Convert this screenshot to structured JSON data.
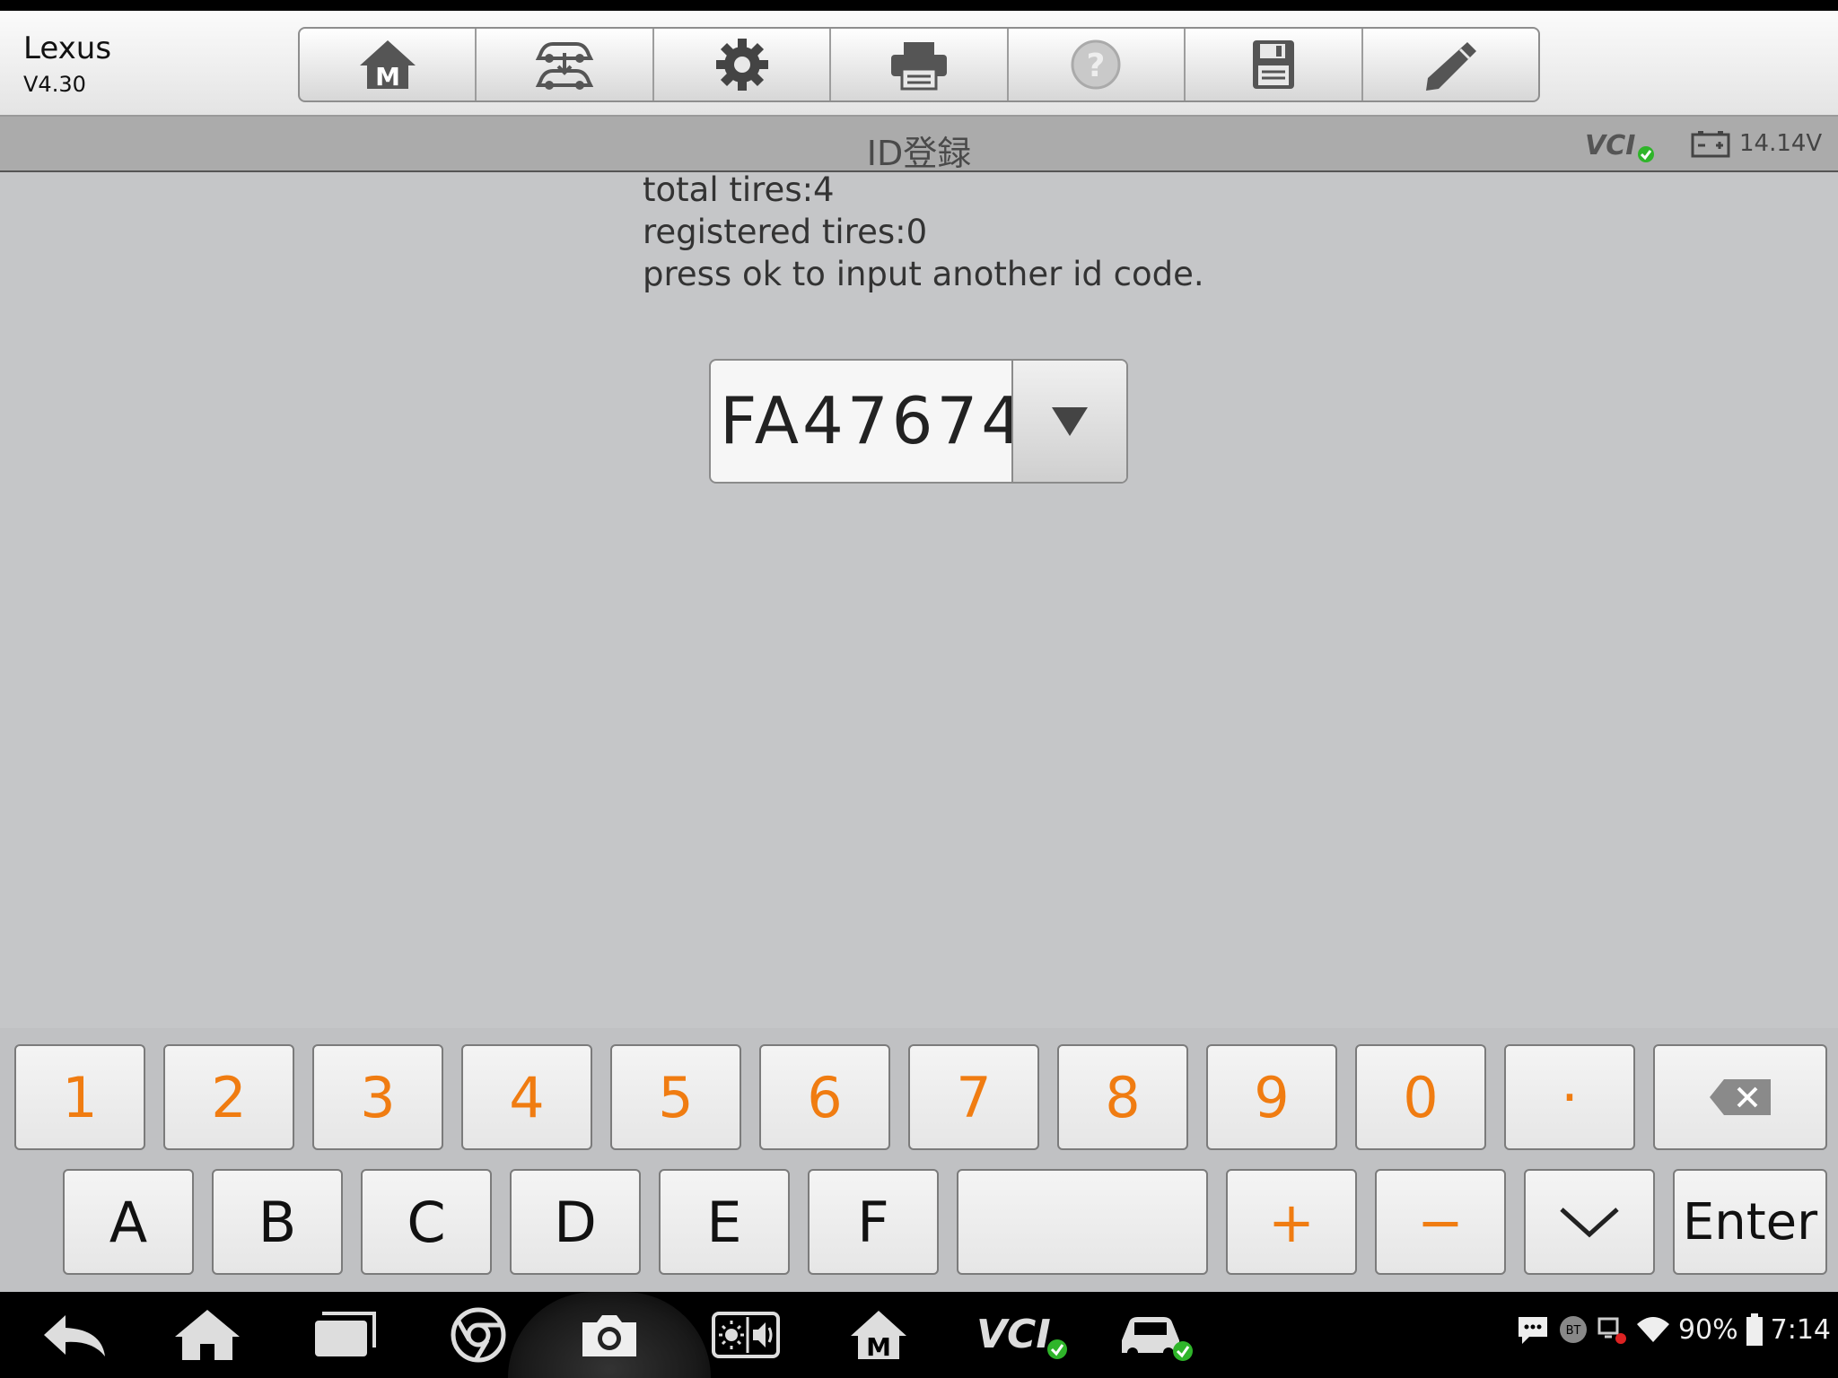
{
  "app": {
    "title": "Lexus",
    "version": "V4.30"
  },
  "toolbar": [
    {
      "icon": "home-m-icon"
    },
    {
      "icon": "vehicle-swap-icon"
    },
    {
      "icon": "gear-icon"
    },
    {
      "icon": "printer-icon"
    },
    {
      "icon": "help-icon"
    },
    {
      "icon": "save-icon"
    },
    {
      "icon": "pencil-icon"
    }
  ],
  "subheader": {
    "title": "ID登録",
    "vcl_label": "VCI",
    "battery_voltage": "14.14V"
  },
  "content": {
    "messages": [
      "total tires:4",
      "registered tires:0",
      "press ok to input another id code."
    ],
    "id_code": "FA47674"
  },
  "keyboard": {
    "row1": [
      "1",
      "2",
      "3",
      "4",
      "5",
      "6",
      "7",
      "8",
      "9",
      "0",
      "·"
    ],
    "row2_letters": [
      "A",
      "B",
      "C",
      "D",
      "E",
      "F"
    ],
    "plus": "+",
    "minus": "−",
    "enter": "Enter"
  },
  "statusbar": {
    "battery": "90%",
    "time": "7:14",
    "bt": "BT"
  },
  "colors": {
    "key_number": "#f07c11",
    "accent_green": "#2fb52a"
  }
}
